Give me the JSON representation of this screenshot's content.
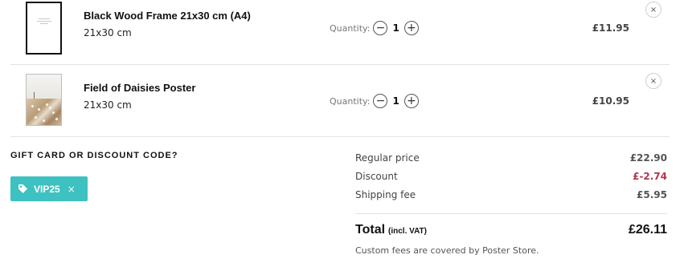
{
  "items": [
    {
      "title": "Black Wood Frame 21x30 cm (A4)",
      "size": "21x30 cm",
      "quantity_label": "Quantity:",
      "quantity": "1",
      "decrement_symbol": "−",
      "increment_symbol": "+",
      "price": "£11.95",
      "remove_symbol": "×",
      "image_icon": "black-frame-thumbnail"
    },
    {
      "title": "Field of Daisies Poster",
      "size": "21x30 cm",
      "quantity_label": "Quantity:",
      "quantity": "1",
      "decrement_symbol": "−",
      "increment_symbol": "+",
      "price": "£10.95",
      "remove_symbol": "×",
      "image_icon": "daisy-field-poster-thumbnail"
    }
  ],
  "discount": {
    "heading": "GIFT CARD OR DISCOUNT CODE?",
    "applied_code": "VIP25",
    "chip_icon": "tag-icon",
    "remove_symbol": "×",
    "chip_color": "#3ec1c1"
  },
  "summary": {
    "regular_price_label": "Regular price",
    "regular_price": "£22.90",
    "discount_label": "Discount",
    "discount_value": "£-2.74",
    "discount_color": "#b0374f",
    "shipping_label": "Shipping fee",
    "shipping_value": "£5.95",
    "total_label": "Total",
    "total_suffix": "(incl. VAT)",
    "total_value": "£26.11",
    "customs_note": "Custom fees are covered by Poster Store."
  }
}
